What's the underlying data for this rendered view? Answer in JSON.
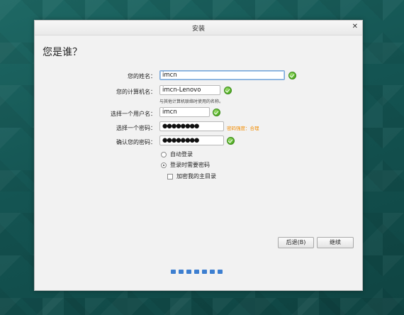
{
  "window": {
    "title": "安装"
  },
  "page": {
    "heading": "您是谁？"
  },
  "form": {
    "name": {
      "label": "您的姓名：",
      "value": "imcn"
    },
    "computer": {
      "label": "您的计算机名：",
      "value": "imcn-Lenovo",
      "hint": "与其他计算机联络时使用的名称。"
    },
    "username": {
      "label": "选择一个用户名：",
      "value": "imcn"
    },
    "password": {
      "label": "选择一个密码：",
      "value": "●●●●●●●●",
      "strength": "密码强度：合理"
    },
    "confirm": {
      "label": "确认您的密码：",
      "value": "●●●●●●●●"
    }
  },
  "options": {
    "auto_login": {
      "label": "自动登录",
      "selected": false
    },
    "require_password": {
      "label": "登录时需要密码",
      "selected": true
    },
    "encrypt_home": {
      "label": "加密我的主目录",
      "checked": false
    }
  },
  "buttons": {
    "back": "后退(B)",
    "continue": "继续"
  },
  "progress": {
    "steps_total": 7
  }
}
